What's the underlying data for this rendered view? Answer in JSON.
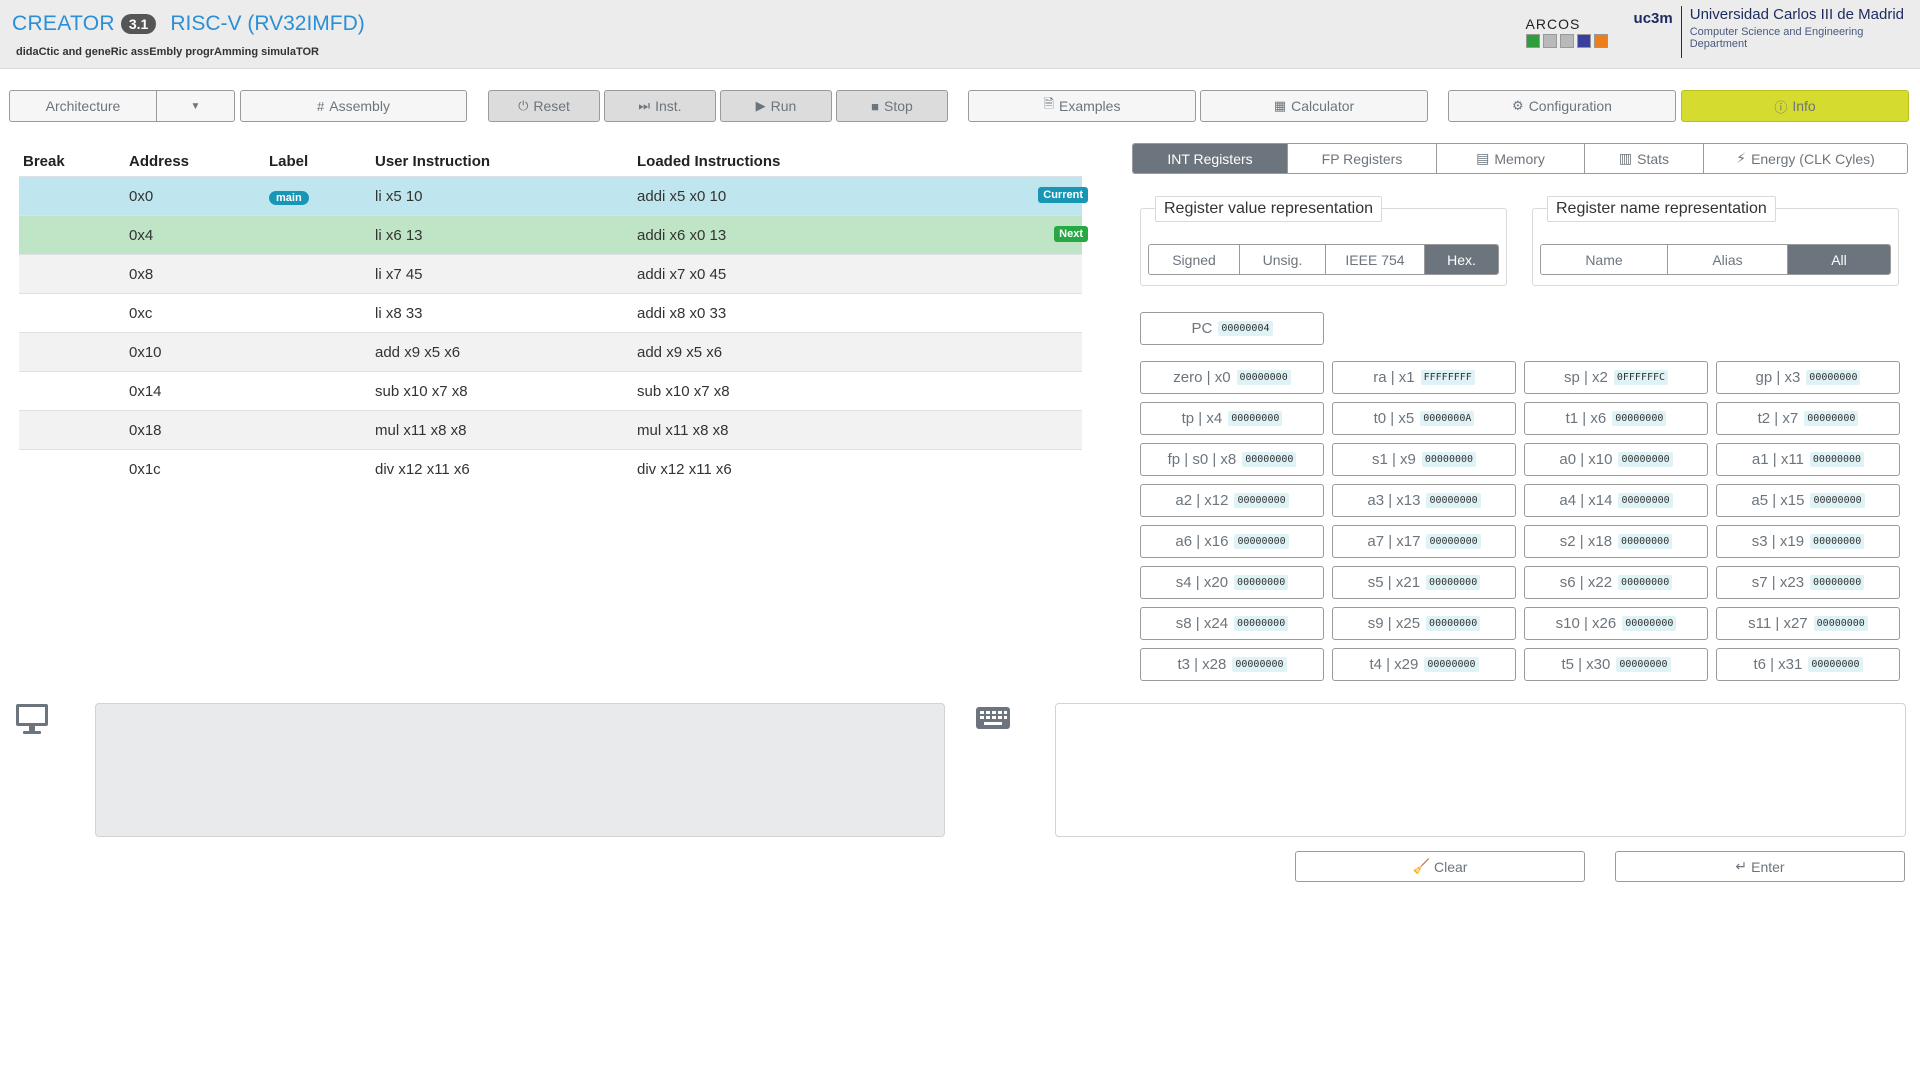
{
  "header": {
    "app_name": "CREATOR",
    "version": "3.1",
    "architecture": "RISC-V (RV32IMFD)",
    "subtitle": "didaCtic and geneRic assEmbly progrAmming simulaTOR",
    "arcos_label": "ARCOS",
    "uc3m_mark": "uc3m",
    "university": "Universidad Carlos III de Madrid",
    "department": "Computer Science and Engineering Department"
  },
  "toolbar": {
    "architecture": "Architecture",
    "assembly": "Assembly",
    "reset": "Reset",
    "inst": "Inst.",
    "run": "Run",
    "stop": "Stop",
    "examples": "Examples",
    "calculator": "Calculator",
    "configuration": "Configuration",
    "info": "Info"
  },
  "instructions": {
    "headers": {
      "break": "Break",
      "address": "Address",
      "label": "Label",
      "user": "User Instruction",
      "loaded": "Loaded Instructions"
    },
    "rows": [
      {
        "address": "0x0",
        "label": "main",
        "user": "li x5 10",
        "loaded": "addi x5 x0 10",
        "badge": "Current"
      },
      {
        "address": "0x4",
        "label": "",
        "user": "li x6 13",
        "loaded": "addi x6 x0 13",
        "badge": "Next"
      },
      {
        "address": "0x8",
        "label": "",
        "user": "li x7 45",
        "loaded": "addi x7 x0 45",
        "badge": ""
      },
      {
        "address": "0xc",
        "label": "",
        "user": "li x8 33",
        "loaded": "addi x8 x0 33",
        "badge": ""
      },
      {
        "address": "0x10",
        "label": "",
        "user": "add x9 x5 x6",
        "loaded": "add x9 x5 x6",
        "badge": ""
      },
      {
        "address": "0x14",
        "label": "",
        "user": "sub x10 x7 x8",
        "loaded": "sub x10 x7 x8",
        "badge": ""
      },
      {
        "address": "0x18",
        "label": "",
        "user": "mul x11 x8 x8",
        "loaded": "mul x11 x8 x8",
        "badge": ""
      },
      {
        "address": "0x1c",
        "label": "",
        "user": "div x12 x11 x6",
        "loaded": "div x12 x11 x6",
        "badge": ""
      }
    ]
  },
  "tabs": {
    "int": "INT Registers",
    "fp": "FP Registers",
    "memory": "Memory",
    "stats": "Stats",
    "energy": "Energy (CLK Cyles)"
  },
  "value_repr": {
    "title": "Register value representation",
    "options": [
      "Signed",
      "Unsig.",
      "IEEE 754",
      "Hex."
    ],
    "selected": "Hex."
  },
  "name_repr": {
    "title": "Register name representation",
    "options": [
      "Name",
      "Alias",
      "All"
    ],
    "selected": "All"
  },
  "pc": {
    "name": "PC",
    "value": "00000004"
  },
  "registers": [
    {
      "name": "zero | x0",
      "value": "00000000"
    },
    {
      "name": "ra | x1",
      "value": "FFFFFFFF"
    },
    {
      "name": "sp | x2",
      "value": "0FFFFFFC"
    },
    {
      "name": "gp | x3",
      "value": "00000000"
    },
    {
      "name": "tp | x4",
      "value": "00000000"
    },
    {
      "name": "t0 | x5",
      "value": "0000000A"
    },
    {
      "name": "t1 | x6",
      "value": "00000000"
    },
    {
      "name": "t2 | x7",
      "value": "00000000"
    },
    {
      "name": "fp | s0 | x8",
      "value": "00000000"
    },
    {
      "name": "s1 | x9",
      "value": "00000000"
    },
    {
      "name": "a0 | x10",
      "value": "00000000"
    },
    {
      "name": "a1 | x11",
      "value": "00000000"
    },
    {
      "name": "a2 | x12",
      "value": "00000000"
    },
    {
      "name": "a3 | x13",
      "value": "00000000"
    },
    {
      "name": "a4 | x14",
      "value": "00000000"
    },
    {
      "name": "a5 | x15",
      "value": "00000000"
    },
    {
      "name": "a6 | x16",
      "value": "00000000"
    },
    {
      "name": "a7 | x17",
      "value": "00000000"
    },
    {
      "name": "s2 | x18",
      "value": "00000000"
    },
    {
      "name": "s3 | x19",
      "value": "00000000"
    },
    {
      "name": "s4 | x20",
      "value": "00000000"
    },
    {
      "name": "s5 | x21",
      "value": "00000000"
    },
    {
      "name": "s6 | x22",
      "value": "00000000"
    },
    {
      "name": "s7 | x23",
      "value": "00000000"
    },
    {
      "name": "s8 | x24",
      "value": "00000000"
    },
    {
      "name": "s9 | x25",
      "value": "00000000"
    },
    {
      "name": "s10 | x26",
      "value": "00000000"
    },
    {
      "name": "s11 | x27",
      "value": "00000000"
    },
    {
      "name": "t3 | x28",
      "value": "00000000"
    },
    {
      "name": "t4 | x29",
      "value": "00000000"
    },
    {
      "name": "t5 | x30",
      "value": "00000000"
    },
    {
      "name": "t6 | x31",
      "value": "00000000"
    }
  ],
  "console": {
    "output": "",
    "input": "",
    "clear": "Clear",
    "enter": "Enter"
  },
  "colors": {
    "brand": "#2b8fd6",
    "current_row": "#bfe6ee",
    "next_row": "#bfe5c6",
    "info_button": "#d5dc2f",
    "current_badge": "#1797b5",
    "next_badge": "#28a745"
  },
  "icons": {
    "assembly": "hash-icon",
    "reset": "power-icon",
    "inst": "fast-forward-icon",
    "run": "play-icon",
    "stop": "stop-icon",
    "examples": "file-icon",
    "calculator": "calculator-icon",
    "configuration": "gears-icon",
    "info": "info-circle-icon",
    "memory": "memory-icon",
    "stats": "chart-icon",
    "energy": "bolt-icon",
    "monitor": "monitor-icon",
    "keyboard": "keyboard-icon",
    "clear": "broom-icon",
    "enter": "enter-arrow-icon"
  }
}
